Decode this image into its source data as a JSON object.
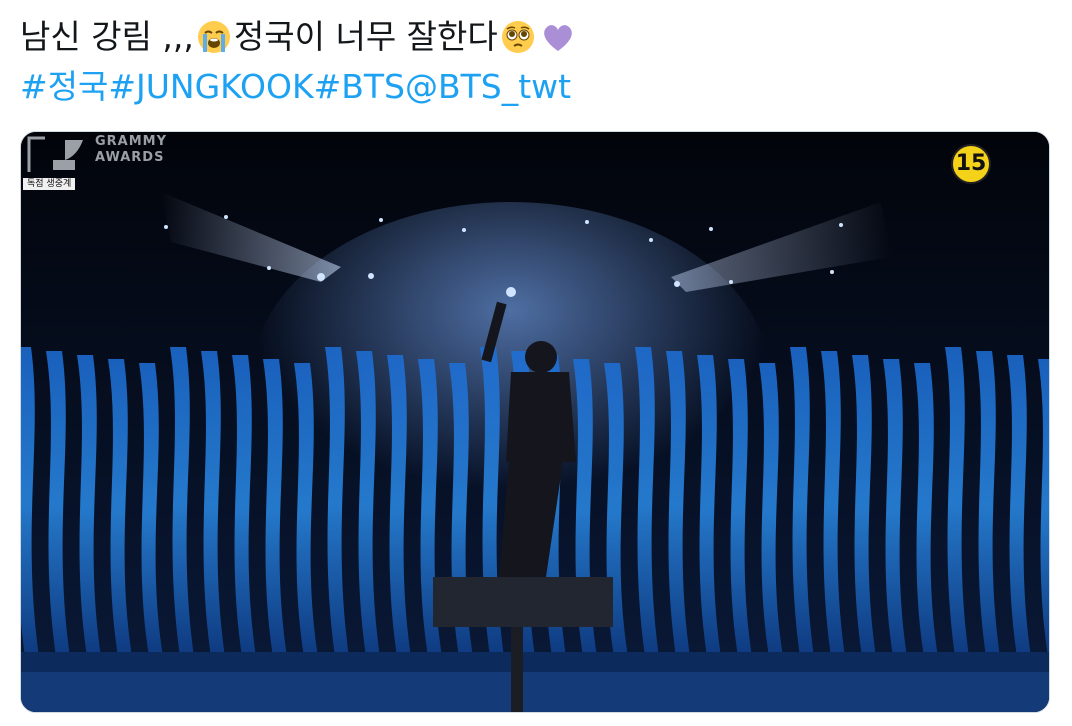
{
  "tweet": {
    "line1": {
      "before": "남신 강림 ,,,",
      "emoji1": "loudly-crying-face",
      "middle": " 정국이 너무 잘한다",
      "emoji2": "pleading-face",
      "emoji3": "purple-heart"
    },
    "hashtags": [
      "#정국",
      "#JUNGKOOK",
      "#BTS",
      "@BTS_twt"
    ],
    "colors": {
      "text": "#14171a",
      "link": "#1da1f2",
      "heart": "#a78bdb"
    }
  },
  "media": {
    "logo_line1": "GRAMMY",
    "logo_line2": "AWARDS",
    "badge": "독점 생중계",
    "rating": "15"
  }
}
